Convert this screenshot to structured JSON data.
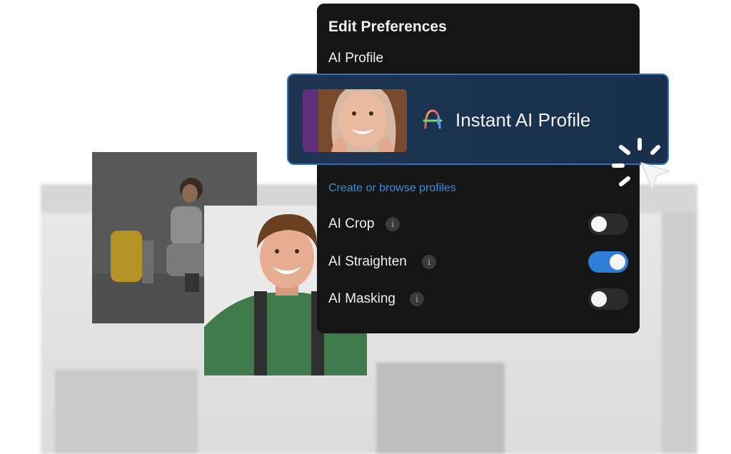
{
  "panel": {
    "title": "Edit Preferences",
    "subtitle": "AI Profile",
    "profile_card": {
      "label": "Instant AI Profile",
      "logo_icon": "ai-profile-logo-icon"
    },
    "link": "Create or browse profiles",
    "toggles": [
      {
        "label": "AI Crop",
        "info_icon": "info-icon",
        "info_glyph": "i",
        "enabled": false
      },
      {
        "label": "AI Straighten",
        "info_icon": "info-icon",
        "info_glyph": "i",
        "enabled": true
      },
      {
        "label": "AI Masking",
        "info_icon": "info-icon",
        "info_glyph": "i",
        "enabled": false
      }
    ]
  },
  "colors": {
    "panel_bg": "#151515",
    "accent": "#2f7fd8",
    "link": "#3a8de0",
    "card_border": "#2f6fc0"
  }
}
